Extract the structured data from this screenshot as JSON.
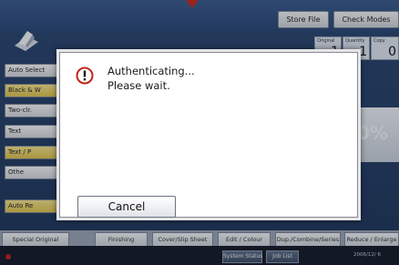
{
  "top": {
    "store_file": "Store File",
    "check_modes": "Check Modes",
    "counters": [
      {
        "label": "Original",
        "value": "1"
      },
      {
        "label": "Quantity",
        "value": "1"
      },
      {
        "label": "Copy",
        "value": "0"
      }
    ]
  },
  "left_buttons": [
    {
      "label": "Auto Select"
    },
    {
      "label": "Black & W"
    },
    {
      "label": "Two-clr."
    },
    {
      "label": "Text"
    },
    {
      "label": "Text / P"
    },
    {
      "label": "Othe"
    },
    {
      "label": "Auto Re"
    }
  ],
  "right": {
    "percent": "0%"
  },
  "bottom_tabs": [
    {
      "label": "Special Original"
    },
    {
      "label": "Finishing"
    },
    {
      "label": "Cover/Slip Sheet"
    },
    {
      "label": "Edit / Colour"
    },
    {
      "label": "Dup./Combine/Series"
    },
    {
      "label": "Reduce / Enlarge"
    }
  ],
  "status": {
    "system_status": "System Status",
    "job_list": "Job List",
    "date": "2006/12/ 6"
  },
  "dialog": {
    "line1": "Authenticating...",
    "line2": "Please wait.",
    "cancel": "Cancel"
  }
}
